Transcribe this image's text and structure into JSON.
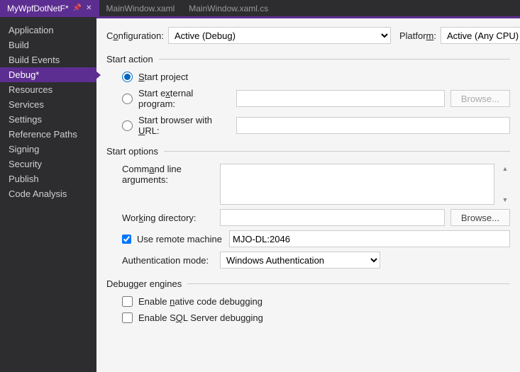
{
  "tabs": {
    "active": "MyWpfDotNetF*",
    "others": [
      "MainWindow.xaml",
      "MainWindow.xaml.cs"
    ]
  },
  "sidebar": {
    "items": [
      "Application",
      "Build",
      "Build Events",
      "Debug*",
      "Resources",
      "Services",
      "Settings",
      "Reference Paths",
      "Signing",
      "Security",
      "Publish",
      "Code Analysis"
    ],
    "selected_index": 3
  },
  "config": {
    "config_label_pre": "C",
    "config_label_ul": "o",
    "config_label_post": "nfiguration:",
    "config_value": "Active (Debug)",
    "platform_label_pre": "Platfor",
    "platform_label_ul": "m",
    "platform_label_post": ":",
    "platform_value": "Active (Any CPU)"
  },
  "start_action": {
    "heading": "Start action",
    "start_project_label": "Start project",
    "start_project_ul": "S",
    "ext_prog_pre": "Start e",
    "ext_prog_ul": "x",
    "ext_prog_post": "ternal program:",
    "ext_prog_value": "",
    "browse1": "Browse...",
    "browser_pre": "Start browser with ",
    "browser_ul": "U",
    "browser_post": "RL:",
    "browser_value": ""
  },
  "start_options": {
    "heading": "Start options",
    "cmd_args_pre": "Comm",
    "cmd_args_ul": "a",
    "cmd_args_post": "nd line arguments:",
    "cmd_args_value": "",
    "workdir_pre": "Wor",
    "workdir_ul": "k",
    "workdir_post": "ing directory:",
    "workdir_value": "",
    "browse2": "Browse...",
    "remote_label": "Use remote machine",
    "remote_checked": true,
    "remote_value": "MJO-DL:2046",
    "auth_label": "Authentication mode:",
    "auth_value": "Windows Authentication"
  },
  "dbg_engines": {
    "heading": "Debugger engines",
    "native_pre": "Enable ",
    "native_ul": "n",
    "native_post": "ative code debugging",
    "native_checked": false,
    "sql_pre": "Enable S",
    "sql_ul": "Q",
    "sql_post": "L Server debugging",
    "sql_checked": false
  }
}
